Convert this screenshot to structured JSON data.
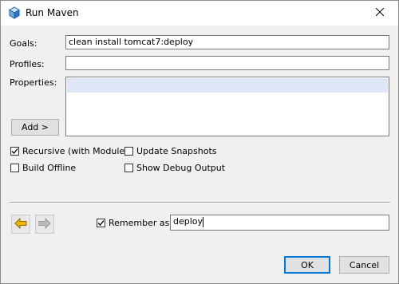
{
  "window": {
    "title": "Run Maven",
    "icon": "maven-cube-icon"
  },
  "form": {
    "goals_label": "Goals:",
    "goals_value": "clean install tomcat7:deploy",
    "profiles_label": "Profiles:",
    "profiles_value": "",
    "properties_label": "Properties:",
    "add_button_label": "Add >"
  },
  "options": {
    "recursive": {
      "label": "Recursive (with Modules)",
      "checked": true
    },
    "update_snapshots": {
      "label": "Update Snapshots",
      "checked": false
    },
    "build_offline": {
      "label": "Build Offline",
      "checked": false
    },
    "show_debug_output": {
      "label": "Show Debug Output",
      "checked": false
    }
  },
  "remember": {
    "label": "Remember as:",
    "checked": true,
    "value": "deploy"
  },
  "nav": {
    "back_icon": "arrow-left-icon",
    "forward_icon": "arrow-right-icon"
  },
  "buttons": {
    "ok": "OK",
    "cancel": "Cancel"
  },
  "colors": {
    "accent": "#0078d7",
    "back_arrow": "#f2b400",
    "selection": "#dfe6f5"
  }
}
